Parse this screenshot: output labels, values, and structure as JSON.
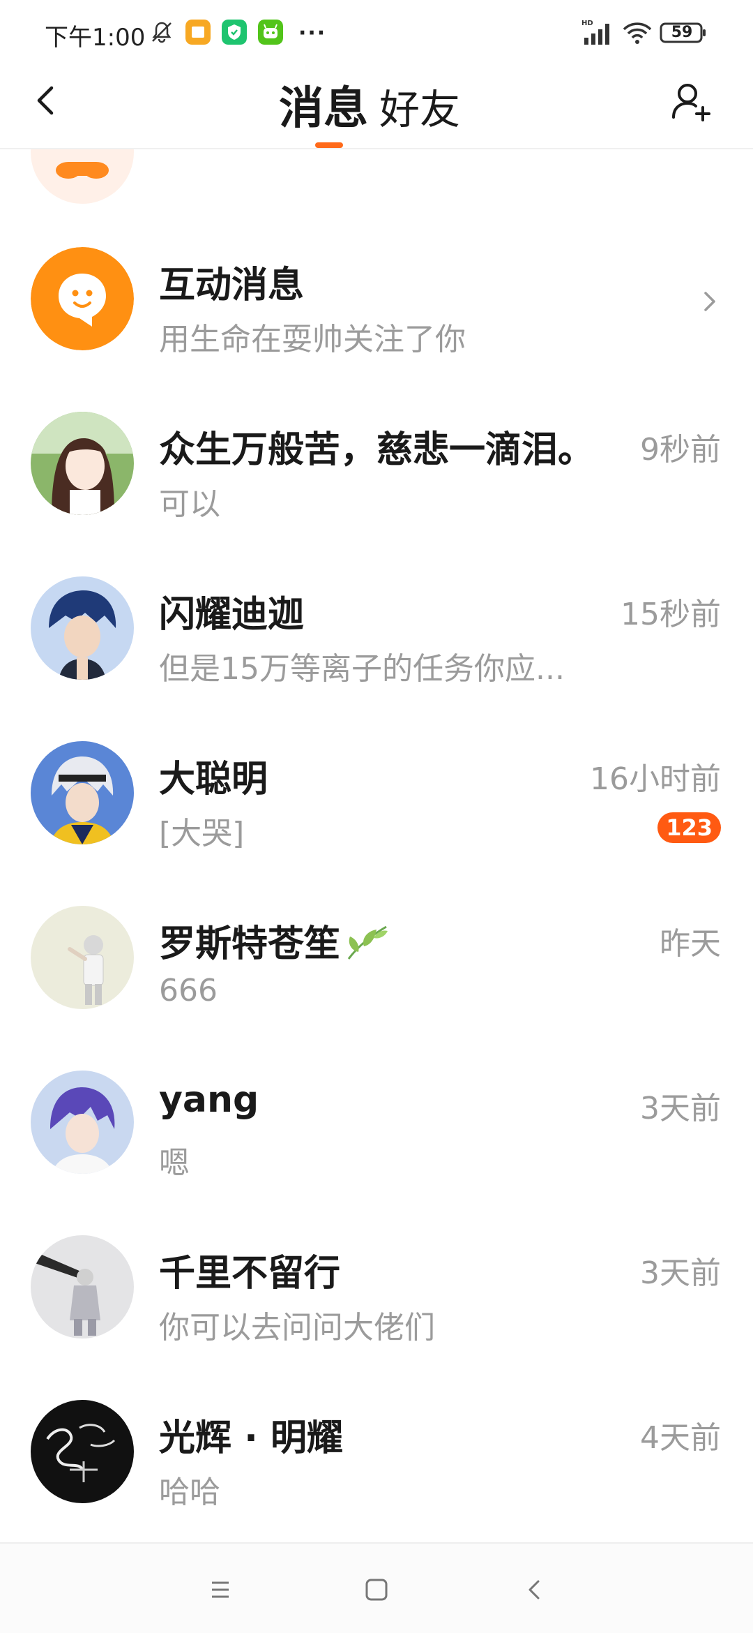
{
  "status_bar": {
    "time": "下午1:00",
    "icons": [
      "mute-bell-icon",
      "notes-app-icon",
      "shield-app-icon",
      "robot-app-icon"
    ],
    "more": "···",
    "battery": "59"
  },
  "header": {
    "tabs": [
      {
        "label": "消息",
        "active": true
      },
      {
        "label": "好友",
        "active": false
      }
    ],
    "accent_color": "#ff6a1a"
  },
  "conversations": [
    {
      "name": "互动消息",
      "preview": "用生命在耍帅关注了你",
      "time": "",
      "badge": "",
      "icon": "chat-bubble-icon"
    },
    {
      "name": "众生万般苦，慈悲一滴泪。",
      "preview": "可以",
      "time": "9秒前",
      "badge": ""
    },
    {
      "name": "闪耀迪迦",
      "preview": "但是15万等离子的任务你应...",
      "time": "15秒前",
      "badge": ""
    },
    {
      "name": "大聪明",
      "preview": "[大哭]",
      "time": "16小时前",
      "badge": "123"
    },
    {
      "name": "罗斯特苍笙",
      "preview": "666",
      "time": "昨天",
      "badge": "",
      "name_emoji": "leaf-emoji"
    },
    {
      "name": "yang",
      "preview": "嗯",
      "time": "3天前",
      "badge": ""
    },
    {
      "name": "千里不留行",
      "preview": "你可以去问问大佬们",
      "time": "3天前",
      "badge": ""
    },
    {
      "name": "光辉 · 明耀",
      "preview": "哈哈",
      "time": "4天前",
      "badge": ""
    }
  ],
  "nav_bar": {
    "buttons": [
      "menu-icon",
      "home-icon",
      "back-icon"
    ]
  }
}
